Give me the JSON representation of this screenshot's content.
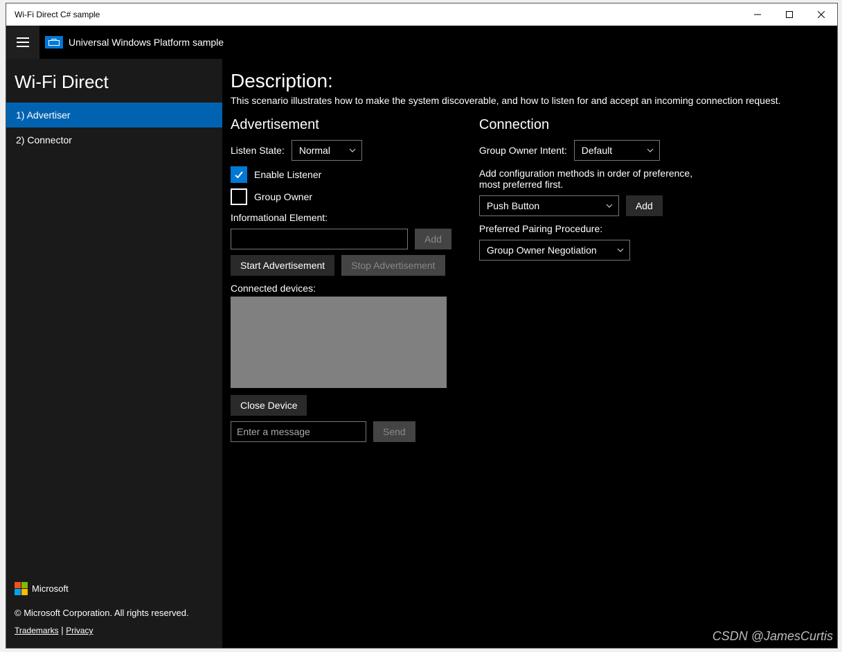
{
  "window": {
    "title": "Wi-Fi Direct C# sample"
  },
  "header": {
    "uwp_label": "Universal Windows Platform sample"
  },
  "sidebar": {
    "title": "Wi-Fi Direct",
    "items": [
      {
        "label": "1) Advertiser",
        "selected": true
      },
      {
        "label": "2) Connector",
        "selected": false
      }
    ],
    "footer": {
      "brand": "Microsoft",
      "copyright": "© Microsoft Corporation. All rights reserved.",
      "links": {
        "trademarks": "Trademarks",
        "privacy": "Privacy"
      }
    }
  },
  "main": {
    "description": {
      "title": "Description:",
      "text": "This scenario illustrates how to make the system discoverable, and how to listen for and accept an incoming connection request."
    },
    "advertisement": {
      "heading": "Advertisement",
      "listen_state_label": "Listen State:",
      "listen_state_value": "Normal",
      "enable_listener_label": "Enable Listener",
      "enable_listener_checked": true,
      "group_owner_label": "Group Owner",
      "group_owner_checked": false,
      "info_element_label": "Informational Element:",
      "info_element_value": "",
      "info_add_label": "Add",
      "start_label": "Start Advertisement",
      "stop_label": "Stop Advertisement",
      "connected_label": "Connected devices:",
      "close_device_label": "Close Device",
      "message_placeholder": "Enter a message",
      "message_value": "",
      "send_label": "Send"
    },
    "connection": {
      "heading": "Connection",
      "go_intent_label": "Group Owner Intent:",
      "go_intent_value": "Default",
      "config_hint": "Add configuration methods in order of preference, most preferred first.",
      "config_value": "Push Button",
      "config_add_label": "Add",
      "pairing_label": "Preferred Pairing Procedure:",
      "pairing_value": "Group Owner Negotiation"
    }
  },
  "watermark": "CSDN @JamesCurtis"
}
